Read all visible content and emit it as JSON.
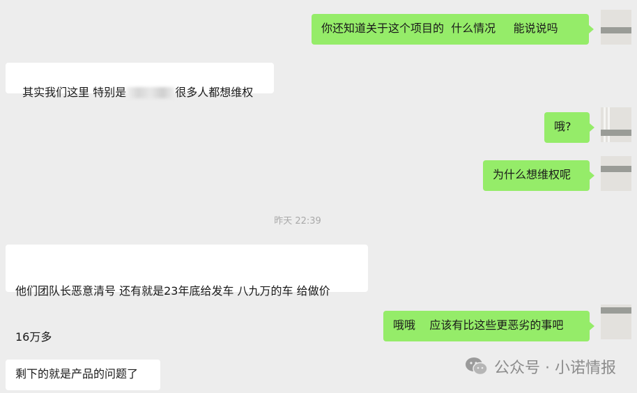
{
  "messages": [
    {
      "id": "m1",
      "side": "out",
      "text": "你还知道关于这个项目的  什么情况     能说说吗"
    },
    {
      "id": "m2",
      "side": "in",
      "text_before": "其实我们这里 特别是",
      "text_after": "很多人都想维权"
    },
    {
      "id": "m3",
      "side": "out",
      "text": "哦?"
    },
    {
      "id": "m4",
      "side": "out",
      "text": "为什么想维权呢"
    },
    {
      "id": "m5",
      "side": "in",
      "line1": "他们团队长恶意清号 还有就是23年底给发车 八九万的车 给做价",
      "line2": "16万多"
    },
    {
      "id": "m6",
      "side": "out",
      "text": "哦哦    应该有比这些更恶劣的事吧"
    },
    {
      "id": "m7",
      "side": "in",
      "text": "剩下的就是产品的问题了"
    }
  ],
  "timestamp": "昨天 22:39",
  "watermark": {
    "text": "公众号 · 小诺情报",
    "icon": "wechat-icon"
  },
  "colors": {
    "background": "#ededed",
    "outgoing": "#95ec69",
    "incoming": "#ffffff"
  }
}
